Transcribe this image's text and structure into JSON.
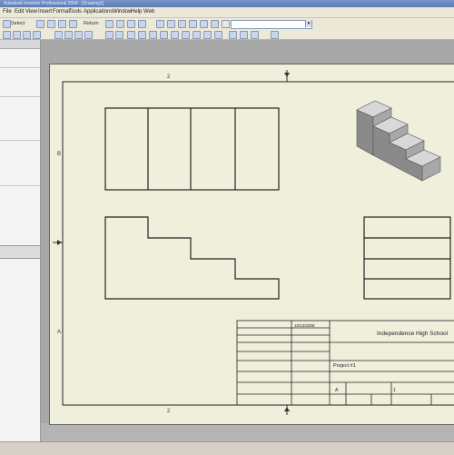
{
  "window": {
    "title": "Autodesk Inventor Professional 2008 - [Drawing1]"
  },
  "menu": [
    "File",
    "Edit",
    "View",
    "Insert",
    "Format",
    "Tools",
    "Applications",
    "Window",
    "Help",
    "Web"
  ],
  "toolbar": {
    "select_label": "Select",
    "return_label": "Return"
  },
  "drawing": {
    "zone_letters": [
      "B",
      "A"
    ],
    "zone_numbers_top": [
      "2",
      "1"
    ],
    "zone_numbers_bottom": [
      "2",
      "1"
    ],
    "title_block": {
      "school": "Independence High School",
      "date": "10/13/2008",
      "project": "Project #1",
      "size_value": "A",
      "sheet_value": "1"
    }
  },
  "colors": {
    "sheet": "#efefdc",
    "lines": "#222222",
    "iso_top": "#d8d8d8",
    "iso_side": "#8a8a8a",
    "iso_front": "#a8a8a8"
  }
}
